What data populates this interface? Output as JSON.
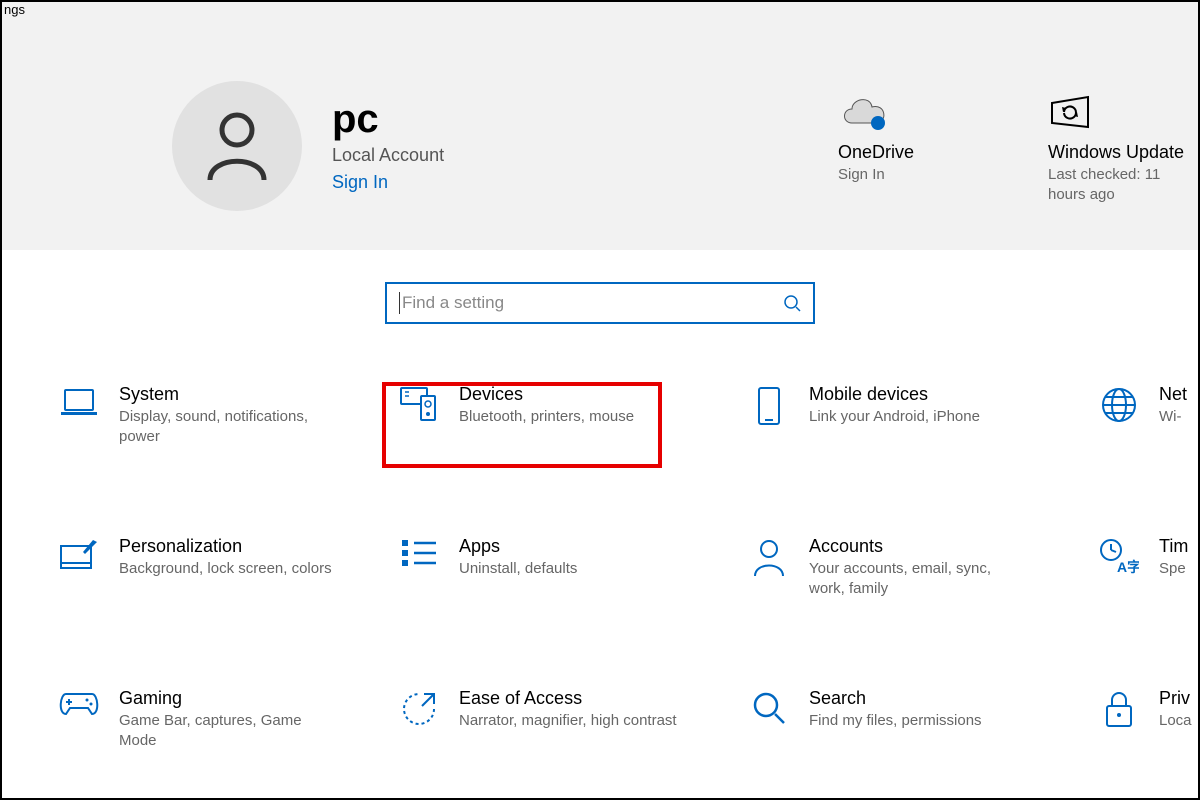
{
  "window": {
    "title_fragment": "ngs"
  },
  "user": {
    "name": "pc",
    "account_type": "Local Account",
    "signin_label": "Sign In"
  },
  "header_cards": {
    "onedrive": {
      "title": "OneDrive",
      "subtitle": "Sign In"
    },
    "update": {
      "title": "Windows Update",
      "subtitle": "Last checked: 11 hours ago"
    }
  },
  "search": {
    "placeholder": "Find a setting"
  },
  "categories": [
    {
      "id": "system",
      "title": "System",
      "desc": "Display, sound, notifications, power"
    },
    {
      "id": "devices",
      "title": "Devices",
      "desc": "Bluetooth, printers, mouse",
      "highlighted": true
    },
    {
      "id": "mobile",
      "title": "Mobile devices",
      "desc": "Link your Android, iPhone"
    },
    {
      "id": "network",
      "title": "Net",
      "desc": "Wi-"
    },
    {
      "id": "personalization",
      "title": "Personalization",
      "desc": "Background, lock screen, colors"
    },
    {
      "id": "apps",
      "title": "Apps",
      "desc": "Uninstall, defaults"
    },
    {
      "id": "accounts",
      "title": "Accounts",
      "desc": "Your accounts, email, sync, work, family"
    },
    {
      "id": "time",
      "title": "Tim",
      "desc": "Spe"
    },
    {
      "id": "gaming",
      "title": "Gaming",
      "desc": "Game Bar, captures, Game Mode"
    },
    {
      "id": "ease",
      "title": "Ease of Access",
      "desc": "Narrator, magnifier, high contrast"
    },
    {
      "id": "search",
      "title": "Search",
      "desc": "Find my files, permissions"
    },
    {
      "id": "privacy",
      "title": "Priv",
      "desc": "Loca"
    }
  ],
  "colors": {
    "accent": "#0067c0",
    "highlight": "#e60000"
  }
}
